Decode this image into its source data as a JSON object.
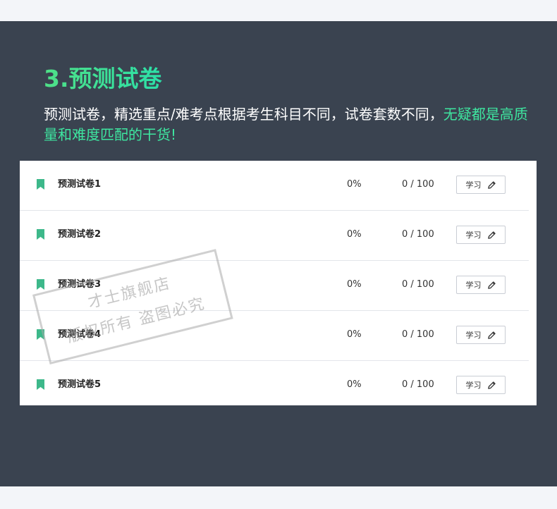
{
  "header": {
    "title": "3.预测试卷",
    "desc_main": "预测试卷，精选重点/难考点根据考生科目不同，试卷套数不同，",
    "desc_accent": "无疑都是高质量和难度匹配的干货!"
  },
  "rows": [
    {
      "title": "预测试卷1",
      "percent": "0%",
      "score": "0 / 100",
      "button": "学习"
    },
    {
      "title": "预测试卷2",
      "percent": "0%",
      "score": "0 / 100",
      "button": "学习"
    },
    {
      "title": "预测试卷3",
      "percent": "0%",
      "score": "0 / 100",
      "button": "学习"
    },
    {
      "title": "预测试卷4",
      "percent": "0%",
      "score": "0 / 100",
      "button": "学习"
    },
    {
      "title": "预测试卷5",
      "percent": "0%",
      "score": "0 / 100",
      "button": "学习"
    }
  ],
  "watermark": {
    "line1": "才士旗舰店",
    "line2": "版权所有 盗图必究"
  },
  "colors": {
    "accent": "#3ee6a0",
    "panel": "#3a4350",
    "bookmark": "#3db88a"
  }
}
